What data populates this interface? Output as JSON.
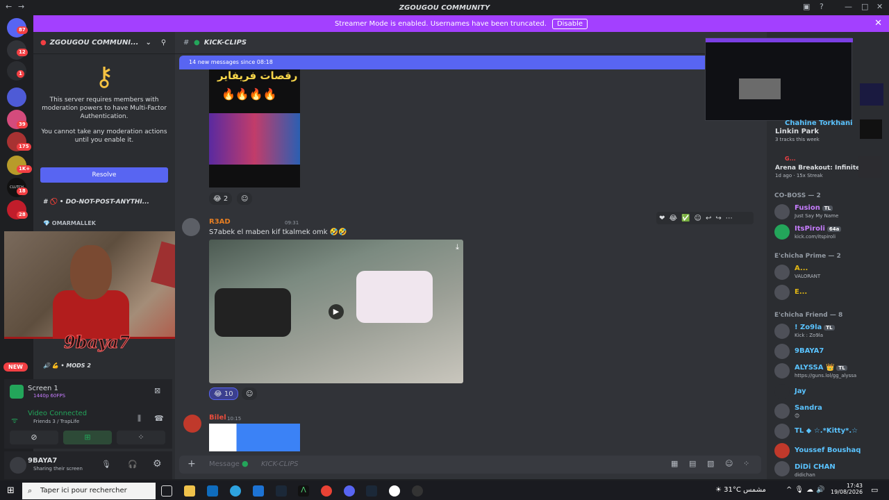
{
  "app": {
    "title": "ZGOUGOU COMMUNITY"
  },
  "banner": {
    "text": "Streamer Mode is enabled. Usernames have been truncated.",
    "button": "Disable"
  },
  "rail": {
    "badges": [
      "87",
      "12",
      "1",
      "39",
      "175",
      "1K+",
      "18",
      "28"
    ],
    "clutch": "CLUTCH"
  },
  "server": {
    "name": "ZGOUGOU COMMUNI...",
    "mfa_text": "This server requires members with moderation powers to have Multi-Factor Authentication.",
    "mfa_sub": "You cannot take any moderation actions until you enable it.",
    "resolve": "Resolve",
    "channels": [
      "DO-NOT-POST-ANYTHI...",
      "MODS 2"
    ],
    "voice_user": "OMARMALLEK",
    "new_badge": "NEW"
  },
  "voice": {
    "screen": "Screen 1",
    "screen_sub": "1440p 60FPS",
    "status": "Video Connected",
    "status_sub": "Friends 3 / TrapLife"
  },
  "user": {
    "name": "9BAYA7",
    "status": "Sharing their screen"
  },
  "cam_logo": "9baya7",
  "channel": {
    "name": "KICK-CLIPS",
    "new_messages": "14 new messages since 08:18",
    "composer_placeholder": "Message #",
    "composer_channel": "KICK-CLIPS"
  },
  "messages": [
    {
      "thumb_title": "رقصات فريفاير",
      "reaction_count": "2"
    },
    {
      "author": "R3AD",
      "time": "09:31",
      "text": "S7abek el maben kif tkalmek omk 🤣🤣",
      "reaction_count": "10"
    },
    {
      "author": "Bilel",
      "time": "10:15"
    }
  ],
  "members": {
    "activity": [
      {
        "name": "Chahine Torkhani",
        "title": "Linkin Park",
        "sub": "3 tracks this week"
      },
      {
        "name": "G...",
        "title": "Arena Breakout: Infinite",
        "sub": "1d ago · 15x Streak"
      }
    ],
    "groups": [
      {
        "label": "CO-BOSS — 2",
        "items": [
          {
            "name": "Fusion",
            "tag": "TL",
            "sub": "Just Say My Name",
            "color": "#c77dff"
          },
          {
            "name": "ItsPiroli",
            "tag": "64a",
            "sub": "kick.com/itspiroli",
            "color": "#c77dff"
          }
        ]
      },
      {
        "label": "E'chicha Prime — 2",
        "items": [
          {
            "name": "A...",
            "sub": "VALORANT",
            "color": "#e2b714"
          },
          {
            "name": "E...",
            "sub": "",
            "color": "#e2b714"
          }
        ]
      },
      {
        "label": "E'chicha Friend — 8",
        "items": [
          {
            "name": "! Zo9la",
            "tag": "TL",
            "sub": "Kick : Zo9la",
            "color": "#5ac3ff"
          },
          {
            "name": "9BAYA7",
            "sub": "",
            "color": "#5ac3ff"
          },
          {
            "name": "ALYSSA 👑",
            "tag": "TL",
            "sub": "https://guns.lol/gg_alyssa",
            "color": "#5ac3ff"
          },
          {
            "name": "Jay",
            "sub": "",
            "color": "#5ac3ff"
          },
          {
            "name": "Sandra",
            "sub": "😊",
            "color": "#5ac3ff"
          },
          {
            "name": "TL ◆ ☆.*Kitty*.☆",
            "sub": "",
            "color": "#5ac3ff"
          },
          {
            "name": "Youssef Boushaq",
            "sub": "",
            "color": "#5ac3ff"
          },
          {
            "name": "DiDi CHAN",
            "sub": "didichan",
            "color": "#5ac3ff"
          }
        ]
      }
    ]
  },
  "taskbar": {
    "search": "Taper ici pour rechercher",
    "weather": "31°C",
    "weather_text": "مشمس",
    "time": "17:43",
    "date": "19/08/2026"
  }
}
